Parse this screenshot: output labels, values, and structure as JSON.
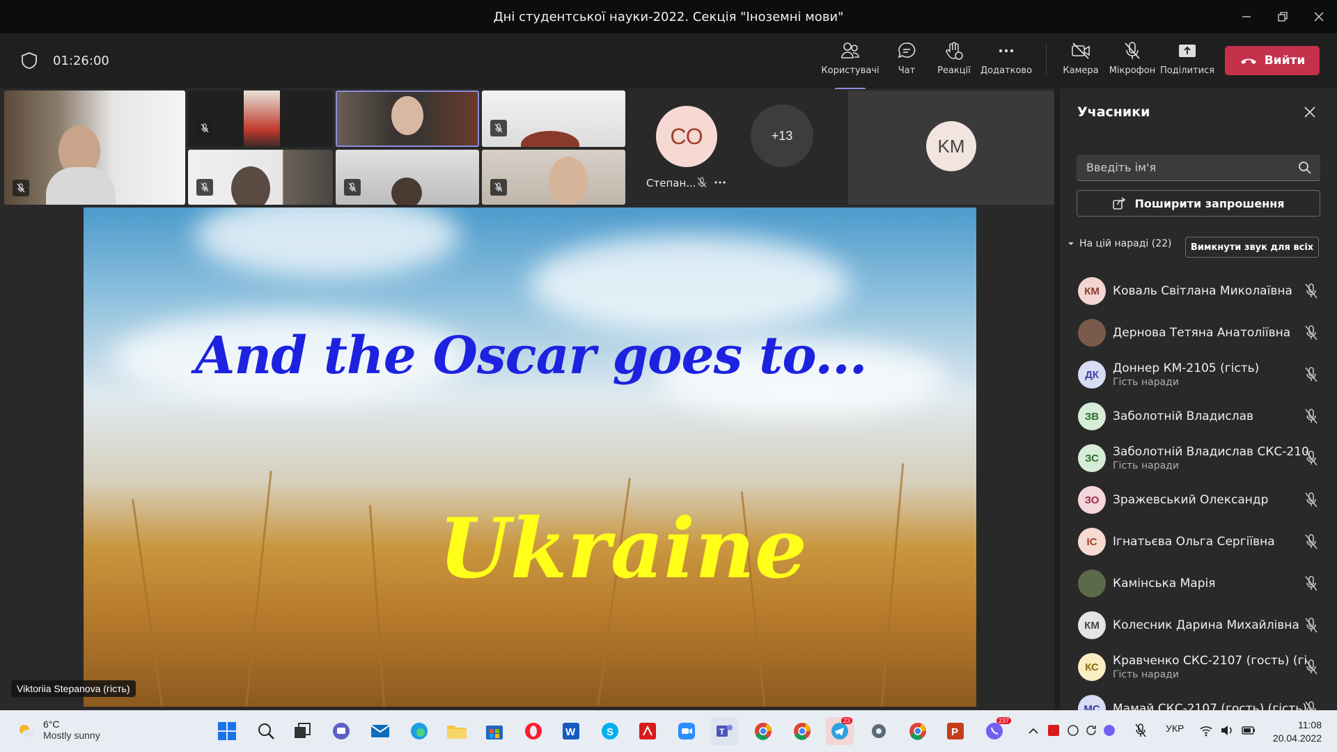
{
  "window": {
    "title": "Дні студентської науки-2022. Секція \"Іноземні мови\""
  },
  "meeting": {
    "timer": "01:26:00"
  },
  "toolbar": {
    "participants": "Користувачі",
    "chat": "Чат",
    "reactions": "Реакції",
    "more": "Додатково",
    "camera": "Камера",
    "mic": "Мікрофон",
    "share": "Поділитися",
    "leave": "Вийти"
  },
  "gallery": {
    "co_initials": "СО",
    "co_name": "Степан...",
    "overflow_count": "+13",
    "km_initials": "KM"
  },
  "slide": {
    "heading": "And the Oscar goes to...",
    "answer": "Ukraine"
  },
  "presenter": {
    "name": "Viktoriia Stepanova (гість)"
  },
  "panel": {
    "title": "Учасники",
    "search_placeholder": "Введіть ім'я",
    "invite": "Поширити запрошення",
    "section_label": "На цій нараді (22)",
    "mute_all": "Вимкнути звук для всіх",
    "participants": [
      {
        "initials": "КМ",
        "name": "Коваль Світлана Миколаївна",
        "sub": "",
        "color": "#f3d6d1",
        "fg": "#8a3b2d"
      },
      {
        "initials": "",
        "name": "Дернова Тетяна Анатоліївна",
        "sub": "",
        "color": "#7a5a4a",
        "fg": "#fff"
      },
      {
        "initials": "ДК",
        "name": "Доннер КМ-2105 (гість)",
        "sub": "Гість наради",
        "color": "#d9dcf5",
        "fg": "#3a3f9a"
      },
      {
        "initials": "ЗВ",
        "name": "Заболотній Владислав",
        "sub": "",
        "color": "#d6ecd6",
        "fg": "#2f6b2f"
      },
      {
        "initials": "ЗС",
        "name": "Заболотній Владислав СКС-210...",
        "sub": "Гість наради",
        "color": "#d6ecd6",
        "fg": "#2f6b2f"
      },
      {
        "initials": "ЗО",
        "name": "Зражевський Олександр",
        "sub": "",
        "color": "#f5d6dc",
        "fg": "#9a2f45"
      },
      {
        "initials": "ІС",
        "name": "Ігнатьєва Ольга Сергіївна",
        "sub": "",
        "color": "#f7dad2",
        "fg": "#a0402a"
      },
      {
        "initials": "",
        "name": "Камінська Марія",
        "sub": "",
        "color": "#5b6b4a",
        "fg": "#fff"
      },
      {
        "initials": "КМ",
        "name": "Колесник Дарина Михайлівна",
        "sub": "",
        "color": "#e4e4e4",
        "fg": "#444"
      },
      {
        "initials": "КС",
        "name": "Кравченко СКС-2107 (гость) (гі...",
        "sub": "Гість наради",
        "color": "#fbedc2",
        "fg": "#8a6a10"
      },
      {
        "initials": "МС",
        "name": "Мамай СКС-2107 (гость) (гість)",
        "sub": "",
        "color": "#d9dcf5",
        "fg": "#3a3f9a"
      }
    ]
  },
  "taskbar": {
    "temp": "6°C",
    "weather": "Mostly sunny",
    "lang": "УКР",
    "time": "11:08",
    "date": "20.04.2022",
    "telegram_badge": "23",
    "viber_badge": "237"
  }
}
